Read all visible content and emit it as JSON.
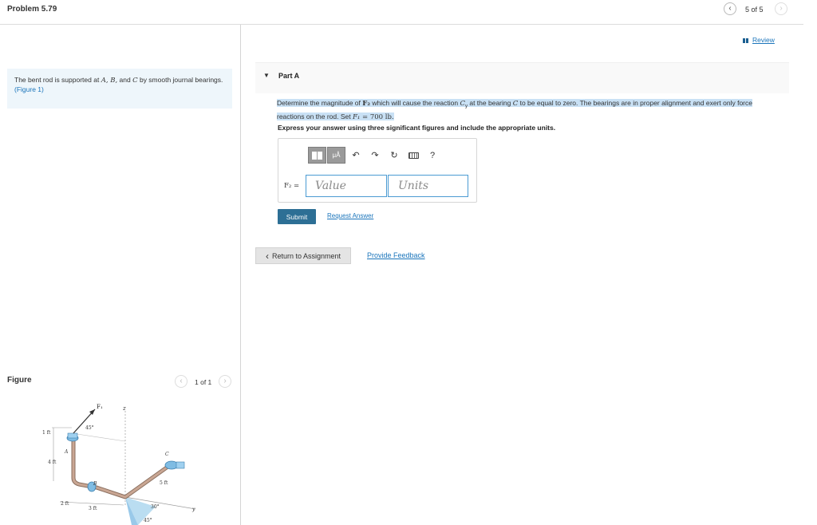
{
  "header": {
    "title": "Problem 5.79",
    "pager": "5 of 5",
    "prev_icon": "‹",
    "next_icon": "›"
  },
  "problem": {
    "text_prefix": "The bent rod is supported at ",
    "text_vars": "A, B,",
    "text_and": " and ",
    "text_c": "C",
    "text_suffix": " by smooth journal bearings.",
    "figure_link": "(Figure 1)"
  },
  "figure": {
    "heading": "Figure",
    "pager": "1 of 1",
    "labels": {
      "f1": "F₁",
      "z": "z",
      "a": "A",
      "b": "B",
      "c": "C",
      "y": "y",
      "one_ft": "1 ft",
      "four_ft": "4 ft",
      "two_ft": "2 ft",
      "three_ft": "3 ft",
      "five_ft": "5 ft",
      "angle45_top": "45°",
      "angle30": "30°",
      "angle45_bottom": "45°"
    }
  },
  "review": {
    "label": "Review"
  },
  "part_a": {
    "caret": "▼",
    "title": "Part A",
    "question_1": "Determine the magnitude of ",
    "f2_sym": "F₂",
    "question_2": " which will cause the reaction ",
    "cy_sym": "C",
    "cy_sub": "y",
    "question_3": " at the bearing ",
    "c_sym": "C",
    "question_4": " to be equal to zero. The bearings are in proper alignment and exert only force reactions on the rod. Set ",
    "f1_sym": "F₁",
    "question_5": " = 700 lb.",
    "instruction": "Express your answer using three significant figures and include the appropriate units.",
    "toolbar": {
      "mu_label": "μÅ",
      "undo_icon": "↶",
      "redo_icon": "↷",
      "reset_icon": "↻",
      "help_label": "?"
    },
    "answer_label": "F₂ =",
    "value_placeholder": "Value",
    "units_placeholder": "Units",
    "submit_label": "Submit",
    "request_label": "Request Answer"
  },
  "footer": {
    "return_label": "Return to Assignment",
    "return_icon": "‹",
    "feedback_label": "Provide Feedback"
  }
}
